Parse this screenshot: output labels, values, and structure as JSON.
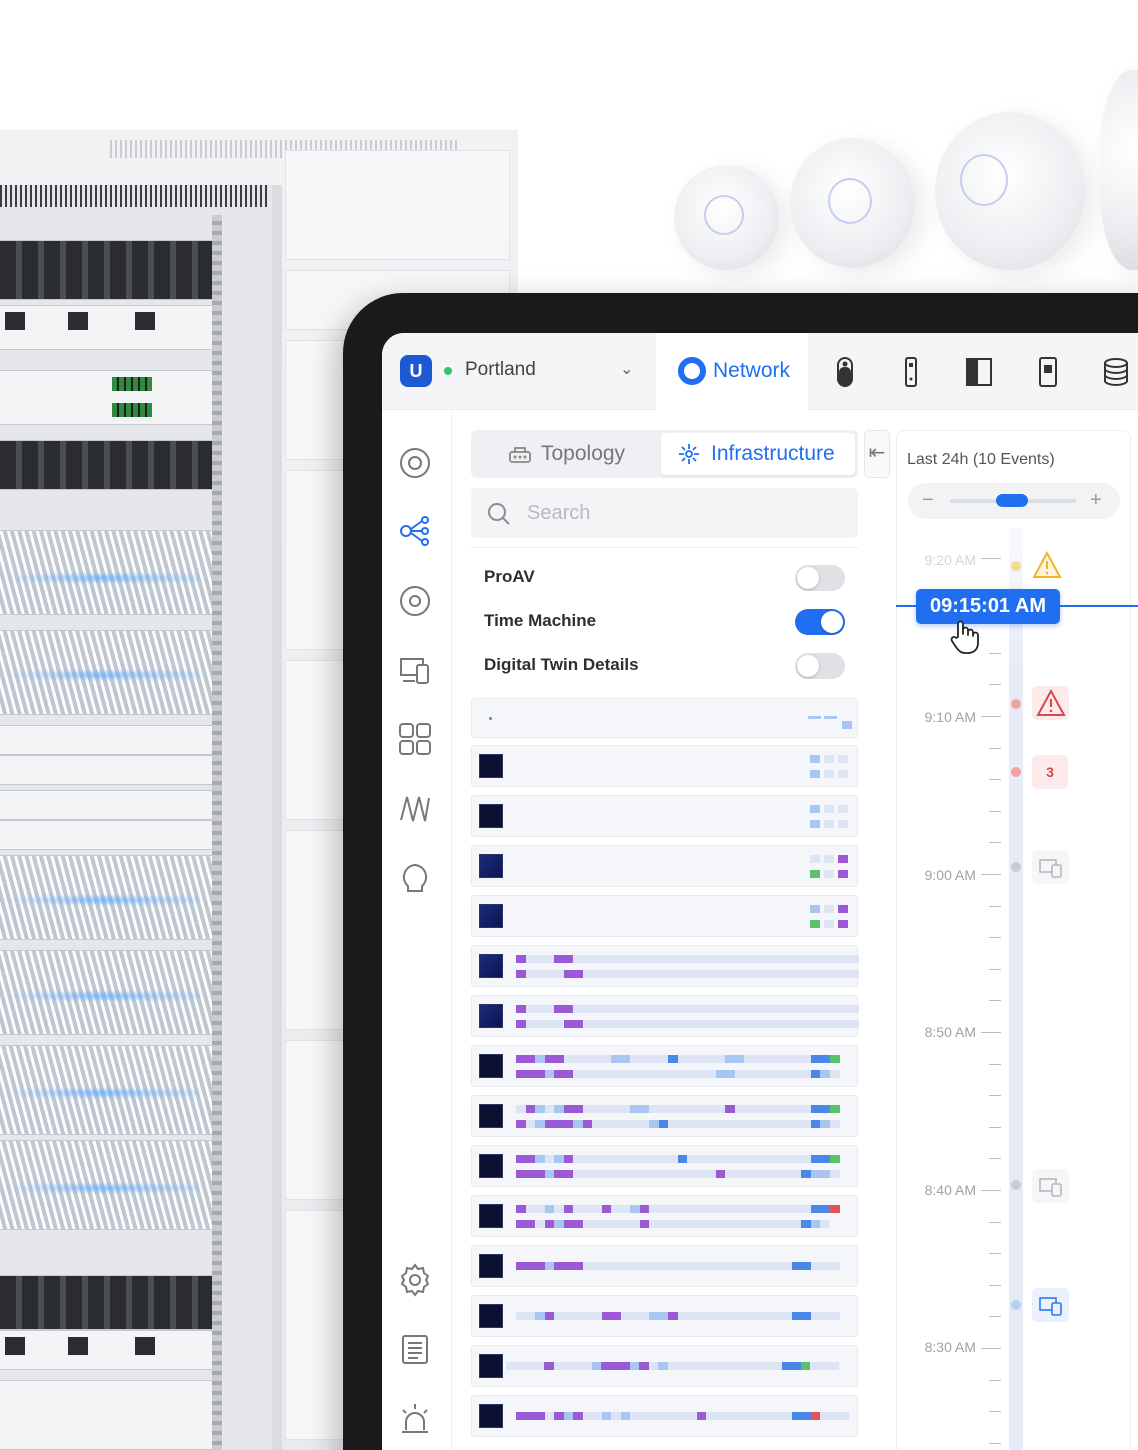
{
  "site": {
    "name": "Portland",
    "status_color": "#38c172"
  },
  "app_tabs": [
    {
      "label": "Network",
      "icon": "network-icon",
      "active": true
    },
    {
      "label": "",
      "icon": "camera-icon"
    },
    {
      "label": "",
      "icon": "access-reader-icon"
    },
    {
      "label": "",
      "icon": "door-icon"
    },
    {
      "label": "",
      "icon": "intercom-icon"
    },
    {
      "label": "",
      "icon": "storage-icon"
    }
  ],
  "left_nav": [
    "dashboard-icon",
    "topology-icon",
    "devices-icon",
    "clients-icon",
    "ports-icon",
    "insights-icon",
    "alerts-icon",
    "settings-icon",
    "logs-icon",
    "notifications-icon"
  ],
  "view_toggle": {
    "tabs": [
      "Topology",
      "Infrastructure"
    ],
    "active": "Infrastructure"
  },
  "search": {
    "placeholder": "Search"
  },
  "options": [
    {
      "label": "ProAV",
      "enabled": false
    },
    {
      "label": "Time Machine",
      "enabled": true
    },
    {
      "label": "Digital Twin Details",
      "enabled": false
    }
  ],
  "timeline": {
    "title": "Last 24h (10 Events)",
    "current_time": "09:15:01 AM",
    "labels": [
      "9:20 AM",
      "9:10 AM",
      "9:00 AM",
      "8:50 AM",
      "8:40 AM",
      "8:30 AM"
    ],
    "events": [
      {
        "type": "warning",
        "color": "#f1c040",
        "icon": "warning-icon"
      },
      {
        "type": "critical",
        "color": "#e45a5a",
        "icon": "warning-icon"
      },
      {
        "type": "count",
        "color": "#e45a5a",
        "count": "3"
      },
      {
        "type": "device",
        "color": "#c0c3c8",
        "icon": "device-icon"
      },
      {
        "type": "device",
        "color": "#c0c3c8",
        "icon": "device-icon"
      },
      {
        "type": "device",
        "color": "#9ec0f6",
        "icon": "device-icon"
      }
    ]
  },
  "colors": {
    "accent": "#1f6ff0",
    "port_idle": "#dde4f3",
    "port_light": "#a9c6f2",
    "port_blue": "#4a87e8",
    "port_purple": "#9b59d6",
    "port_green": "#5cc26a",
    "port_red": "#e25555"
  }
}
